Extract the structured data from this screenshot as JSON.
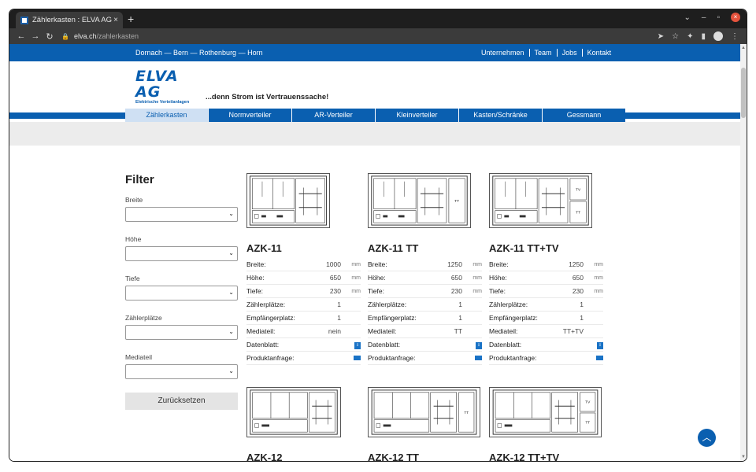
{
  "browser": {
    "tab_title": "Zählerkasten : ELVA AG",
    "tab_close": "×",
    "new_tab": "+",
    "url_domain": "elva.ch",
    "url_path": "/zahlerkasten"
  },
  "site": {
    "locations": "Dornach — Bern — Rothenburg — Horn",
    "top_links": [
      "Unternehmen",
      "Team",
      "Jobs",
      "Kontakt"
    ],
    "logo_text": "ELVA AG",
    "logo_sub": "Elektrische Verteilanlagen",
    "slogan": "...denn Strom ist Vertrauenssache!",
    "menu": [
      "Zählerkasten",
      "Normverteiler",
      "AR-Verteiler",
      "Kleinverteiler",
      "Kasten/Schränke",
      "Gessmann"
    ]
  },
  "filter": {
    "title": "Filter",
    "fields": [
      "Breite",
      "Höhe",
      "Tiefe",
      "Zählerplätze",
      "Mediateil"
    ],
    "reset_label": "Zurücksetzen"
  },
  "spec_labels": {
    "breite": "Breite:",
    "hoehe": "Höhe:",
    "tiefe": "Tiefe:",
    "zaehler": "Zählerplätze:",
    "empf": "Empfängerplatz:",
    "media": "Mediateil:",
    "daten": "Datenblatt:",
    "anfrage": "Produktanfrage:",
    "unit": "mm"
  },
  "products": [
    {
      "name": "AZK-11",
      "breite": "1000",
      "hoehe": "650",
      "tiefe": "230",
      "zaehler": "1",
      "empf": "1",
      "media": "nein"
    },
    {
      "name": "AZK-11 TT",
      "breite": "1250",
      "hoehe": "650",
      "tiefe": "230",
      "zaehler": "1",
      "empf": "1",
      "media": "TT"
    },
    {
      "name": "AZK-11 TT+TV",
      "breite": "1250",
      "hoehe": "650",
      "tiefe": "230",
      "zaehler": "1",
      "empf": "1",
      "media": "TT+TV"
    },
    {
      "name": "AZK-12"
    },
    {
      "name": "AZK-12 TT"
    },
    {
      "name": "AZK-12 TT+TV"
    }
  ],
  "thumb_labels": {
    "tt": "TT",
    "tv": "TV"
  }
}
